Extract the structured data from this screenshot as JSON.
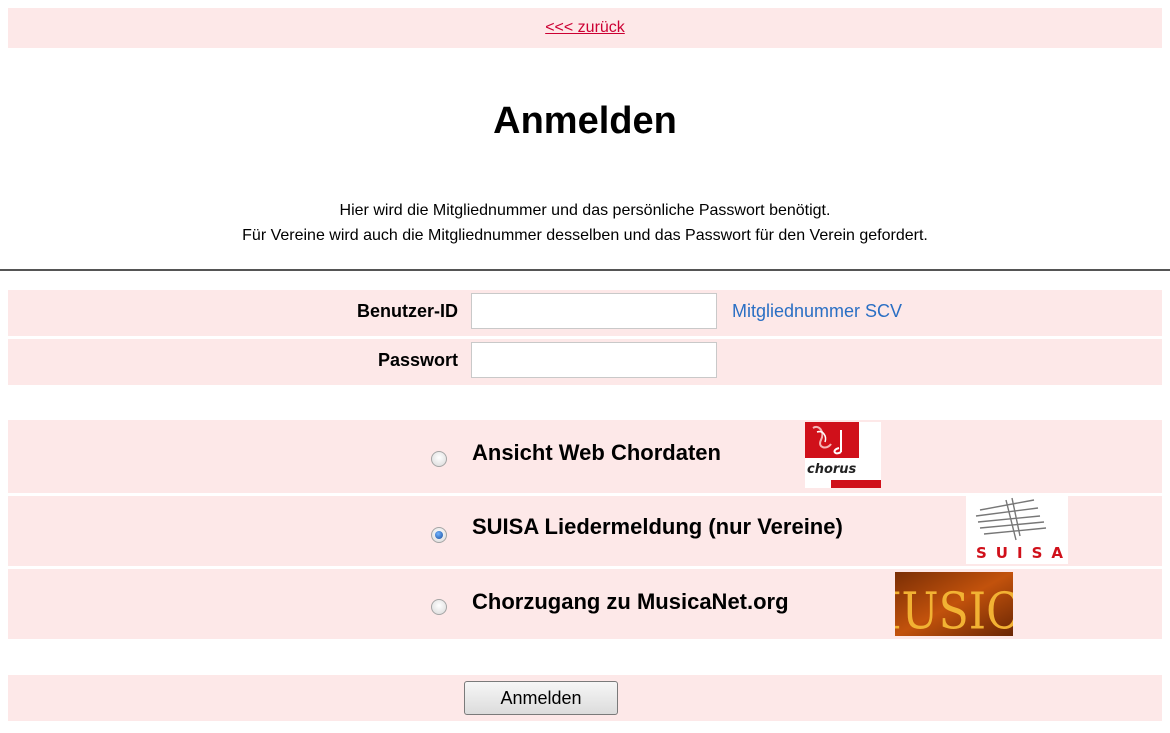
{
  "nav": {
    "back_link": "<<< zurück"
  },
  "page": {
    "title": "Anmelden",
    "intro_line1": "Hier wird die Mitgliednummer und das persönliche Passwort benötigt.",
    "intro_line2": "Für Vereine wird auch die Mitgliednummer desselben und das Passwort für den Verein gefordert."
  },
  "form": {
    "user_label": "Benutzer-ID",
    "user_value": "",
    "user_hint": "Mitgliednummer SCV",
    "password_label": "Passwort",
    "password_value": "",
    "options": [
      {
        "label": "Ansicht Web Chordaten",
        "checked": false,
        "logo": "chorus-logo",
        "logo_text": "chorus"
      },
      {
        "label": "SUISA Liedermeldung (nur Vereine)",
        "checked": true,
        "logo": "suisa-logo",
        "logo_text": "SUISA"
      },
      {
        "label": "Chorzugang zu MusicaNet.org",
        "checked": false,
        "logo": "musica-logo",
        "logo_text": "MUSICA"
      }
    ],
    "submit_label": "Anmelden"
  },
  "colors": {
    "row_background": "#fde8e8",
    "link": "#cc0033",
    "hint": "#2a6fc4"
  }
}
